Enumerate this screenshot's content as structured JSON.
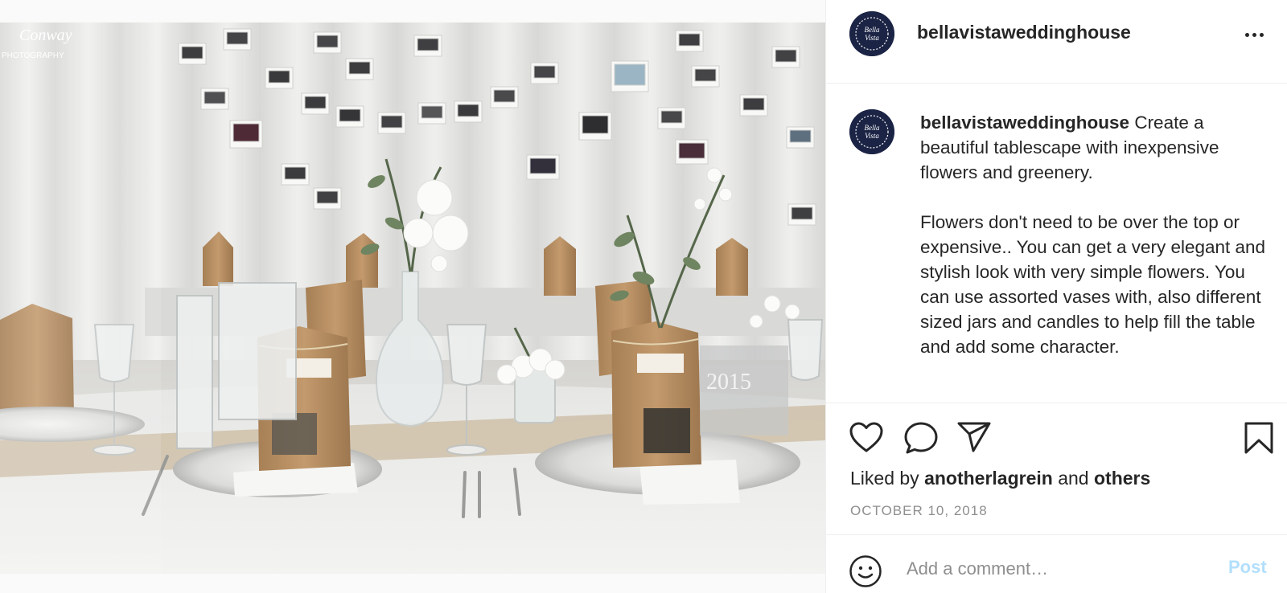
{
  "post": {
    "username": "bellavistaweddinghouse",
    "avatar_text_line1": "Bella",
    "avatar_text_line2": "Vista",
    "caption_username": "bellavistaweddinghouse",
    "caption_intro": " Create a beautiful tablescape with inexpensive flowers and greenery.",
    "caption_body": "Flowers don't need to be over the top or expensive.. You can get a very elegant and stylish look with very simple flowers. You can use assorted vases with, also different sized jars and candles to help fill the table and add some character.",
    "likes_prefix": "Liked by ",
    "liked_by_user": "anotherlagrein",
    "likes_and": " and ",
    "likes_others": "others",
    "date": "OCTOBER 10, 2018"
  },
  "photo": {
    "watermark_line1": "Conway",
    "watermark_line2": "PHOTOGRAPHY",
    "bag_year": "2015"
  },
  "comment": {
    "placeholder": "Add a comment…",
    "post_label": "Post"
  },
  "colors": {
    "avatar_bg": "#1b2445",
    "post_disabled": "#b2dffc",
    "muted_text": "#8e8e8e",
    "kraft": "#b88f62"
  },
  "icons": [
    "heart-icon",
    "comment-icon",
    "share-icon",
    "bookmark-icon",
    "more-icon",
    "emoji-icon"
  ]
}
